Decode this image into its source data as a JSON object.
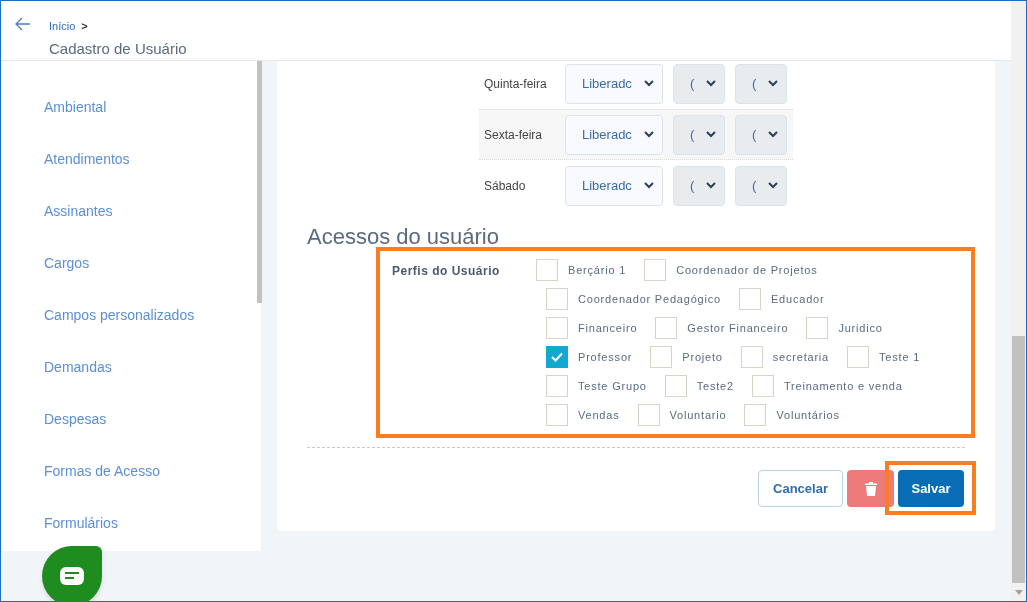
{
  "header": {
    "breadcrumb": "Início",
    "breadcrumb_separator": ">",
    "title": "Cadastro de Usuário"
  },
  "sidebar": {
    "items": [
      {
        "label": "Ambiental"
      },
      {
        "label": "Atendimentos"
      },
      {
        "label": "Assinantes"
      },
      {
        "label": "Cargos"
      },
      {
        "label": "Campos personalizados"
      },
      {
        "label": "Demandas"
      },
      {
        "label": "Despesas"
      },
      {
        "label": "Formas de Acesso"
      },
      {
        "label": "Formulários"
      }
    ]
  },
  "schedule": [
    {
      "day": "Quinta-feira",
      "status": "Liberadc",
      "start": "(",
      "end": "("
    },
    {
      "day": "Sexta-feira",
      "status": "Liberadc",
      "start": "(",
      "end": "("
    },
    {
      "day": "Sábado",
      "status": "Liberadc",
      "start": "(",
      "end": "("
    }
  ],
  "access": {
    "heading": "Acessos do usuário",
    "profiles_label": "Perfis do Usuário",
    "rows": [
      [
        {
          "label": "Berçário 1",
          "checked": false
        },
        {
          "label": "Coordenador de Projetos",
          "checked": false
        }
      ],
      [
        {
          "label": "Coordenador Pedagógico",
          "checked": false
        },
        {
          "label": "Educador",
          "checked": false
        }
      ],
      [
        {
          "label": "Financeiro",
          "checked": false
        },
        {
          "label": "Gestor Financeiro",
          "checked": false
        },
        {
          "label": "Juridico",
          "checked": false
        }
      ],
      [
        {
          "label": "Professor",
          "checked": true
        },
        {
          "label": "Projeto",
          "checked": false
        },
        {
          "label": "secretaria",
          "checked": false
        },
        {
          "label": "Teste 1",
          "checked": false
        }
      ],
      [
        {
          "label": "Teste Grupo",
          "checked": false
        },
        {
          "label": "Teste2",
          "checked": false
        },
        {
          "label": "Treinamento e venda",
          "checked": false
        }
      ],
      [
        {
          "label": "Vendas",
          "checked": false
        },
        {
          "label": "Voluntario",
          "checked": false
        },
        {
          "label": "Voluntários",
          "checked": false
        }
      ]
    ]
  },
  "buttons": {
    "cancel": "Cancelar",
    "save": "Salvar"
  }
}
